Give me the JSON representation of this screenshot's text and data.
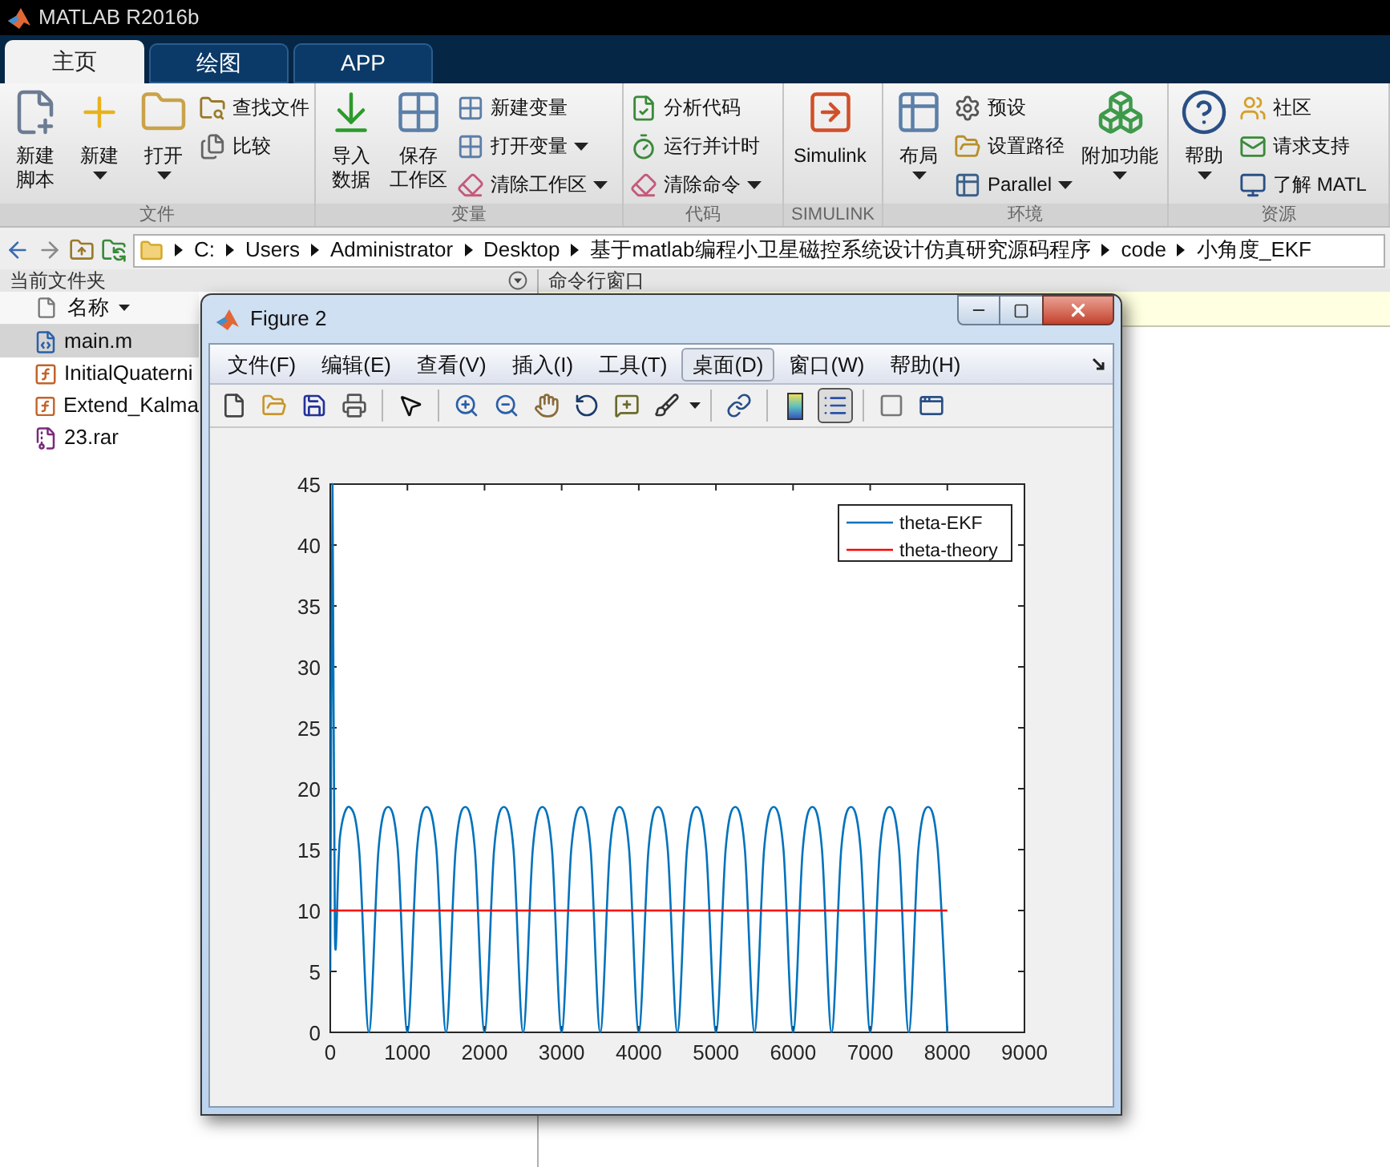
{
  "window": {
    "title": "MATLAB R2016b"
  },
  "tabs": [
    {
      "label": "主页",
      "selected": true
    },
    {
      "label": "绘图",
      "selected": false
    },
    {
      "label": "APP",
      "selected": false
    }
  ],
  "ribbon": {
    "sections": [
      {
        "label": "文件",
        "items": [
          {
            "kind": "large",
            "lines": [
              "新建",
              "脚本"
            ],
            "dropdown": false
          },
          {
            "kind": "large",
            "lines": [
              "新建"
            ],
            "dropdown": true
          },
          {
            "kind": "large",
            "lines": [
              "打开"
            ],
            "dropdown": true
          },
          {
            "kind": "small",
            "items": [
              {
                "label": "查找文件",
                "dropdown": false
              },
              {
                "label": "比较",
                "dropdown": false
              }
            ]
          }
        ]
      },
      {
        "label": "变量",
        "items": [
          {
            "kind": "large",
            "lines": [
              "导入",
              "数据"
            ],
            "dropdown": false
          },
          {
            "kind": "large",
            "lines": [
              "保存",
              "工作区"
            ],
            "dropdown": false
          },
          {
            "kind": "small",
            "items": [
              {
                "label": "新建变量",
                "dropdown": false
              },
              {
                "label": "打开变量",
                "dropdown": true
              },
              {
                "label": "清除工作区",
                "dropdown": true
              }
            ]
          }
        ]
      },
      {
        "label": "代码",
        "items": [
          {
            "kind": "small",
            "items": [
              {
                "label": "分析代码",
                "dropdown": false
              },
              {
                "label": "运行并计时",
                "dropdown": false
              },
              {
                "label": "清除命令",
                "dropdown": true
              }
            ]
          }
        ]
      },
      {
        "label": "SIMULINK",
        "items": [
          {
            "kind": "large",
            "lines": [
              "Simulink"
            ],
            "dropdown": false
          }
        ]
      },
      {
        "label": "环境",
        "items": [
          {
            "kind": "large",
            "lines": [
              "布局"
            ],
            "dropdown": true
          },
          {
            "kind": "small",
            "items": [
              {
                "label": "预设",
                "dropdown": false
              },
              {
                "label": "设置路径",
                "dropdown": false
              },
              {
                "label": "Parallel",
                "dropdown": true
              }
            ]
          },
          {
            "kind": "large",
            "lines": [
              "附加功能"
            ],
            "dropdown": true
          }
        ]
      },
      {
        "label": "资源",
        "items": [
          {
            "kind": "large",
            "lines": [
              "帮助"
            ],
            "dropdown": true
          },
          {
            "kind": "small",
            "items": [
              {
                "label": "社区",
                "dropdown": false
              },
              {
                "label": "请求支持",
                "dropdown": false
              },
              {
                "label": "了解 MATL",
                "dropdown": false
              }
            ]
          }
        ]
      }
    ]
  },
  "address_bar": {
    "segments": [
      "C:",
      "Users",
      "Administrator",
      "Desktop",
      "基于matlab编程小卫星磁控系统设计仿真研究源码程序",
      "code",
      "小角度_EKF"
    ]
  },
  "file_panel": {
    "title": "当前文件夹",
    "column": "名称",
    "files": [
      {
        "name": "main.m",
        "kind": "script",
        "selected": true
      },
      {
        "name": "InitialQuaterni",
        "kind": "function",
        "selected": false
      },
      {
        "name": "Extend_Kalma",
        "kind": "function",
        "selected": false
      },
      {
        "name": "23.rar",
        "kind": "archive",
        "selected": false
      }
    ]
  },
  "command_window": {
    "title": "命令行窗口"
  },
  "figure": {
    "title": "Figure 2",
    "menu": [
      {
        "label": "文件(F)",
        "selected": false
      },
      {
        "label": "编辑(E)",
        "selected": false
      },
      {
        "label": "查看(V)",
        "selected": false
      },
      {
        "label": "插入(I)",
        "selected": false
      },
      {
        "label": "工具(T)",
        "selected": false
      },
      {
        "label": "桌面(D)",
        "selected": true
      },
      {
        "label": "窗口(W)",
        "selected": false
      },
      {
        "label": "帮助(H)",
        "selected": false
      }
    ],
    "toolbar_groups": [
      {
        "tools": [
          {
            "kind": "new",
            "pressed": false,
            "dropdown": false
          },
          {
            "kind": "open",
            "pressed": false,
            "dropdown": false
          },
          {
            "kind": "save",
            "pressed": false,
            "dropdown": false
          },
          {
            "kind": "print",
            "pressed": false,
            "dropdown": false
          }
        ]
      },
      {
        "tools": [
          {
            "kind": "pointer",
            "pressed": false,
            "dropdown": false
          }
        ]
      },
      {
        "tools": [
          {
            "kind": "zoomin",
            "pressed": false,
            "dropdown": false
          },
          {
            "kind": "zoomout",
            "pressed": false,
            "dropdown": false
          },
          {
            "kind": "pan",
            "pressed": false,
            "dropdown": false
          },
          {
            "kind": "rotate",
            "pressed": false,
            "dropdown": false
          },
          {
            "kind": "datatip",
            "pressed": false,
            "dropdown": false
          },
          {
            "kind": "brush",
            "pressed": false,
            "dropdown": true
          }
        ]
      },
      {
        "tools": [
          {
            "kind": "link",
            "pressed": false,
            "dropdown": false
          }
        ]
      },
      {
        "tools": [
          {
            "kind": "colorbar",
            "pressed": false,
            "dropdown": false
          },
          {
            "kind": "legend",
            "pressed": true,
            "dropdown": false
          }
        ]
      },
      {
        "tools": [
          {
            "kind": "hide",
            "pressed": false,
            "dropdown": false
          },
          {
            "kind": "dock",
            "pressed": false,
            "dropdown": false
          }
        ]
      }
    ],
    "chart_data": {
      "type": "line",
      "legend": "top right",
      "xlim": [
        0,
        9000
      ],
      "ylim": [
        0,
        45
      ],
      "xticks": [
        0,
        1000,
        2000,
        3000,
        4000,
        5000,
        6000,
        7000,
        8000,
        9000
      ],
      "yticks": [
        0,
        5,
        10,
        15,
        20,
        25,
        30,
        35,
        40,
        45
      ],
      "x": [
        0,
        30,
        60,
        125,
        250,
        375,
        500,
        625,
        750,
        875,
        1000,
        1125,
        1250,
        1375,
        1500,
        1625,
        1750,
        1875,
        2000,
        2125,
        2250,
        2375,
        2500,
        2625,
        2750,
        2875,
        3000,
        3125,
        3250,
        3375,
        3500,
        3625,
        3750,
        3875,
        4000,
        4125,
        4250,
        4375,
        4500,
        4625,
        4750,
        4875,
        5000,
        5125,
        5250,
        5375,
        5500,
        5625,
        5750,
        5875,
        6000,
        6125,
        6250,
        6375,
        6500,
        6625,
        6750,
        6875,
        7000,
        7125,
        7250,
        7375,
        7500,
        7625,
        7750,
        7875,
        8000
      ],
      "series": [
        {
          "name": "theta-EKF",
          "color": "#0072bd",
          "values": [
            5,
            45,
            8,
            16,
            18.5,
            15,
            0,
            15,
            18.5,
            15,
            0,
            15,
            18.5,
            15,
            0,
            15,
            18.5,
            15,
            0,
            15,
            18.5,
            15,
            0,
            15,
            18.5,
            15,
            0,
            15,
            18.5,
            15,
            0,
            15,
            18.5,
            15,
            0,
            15,
            18.5,
            15,
            0,
            15,
            18.5,
            15,
            0,
            15,
            18.5,
            15,
            0,
            15,
            18.5,
            15,
            0,
            15,
            18.5,
            15,
            0,
            15,
            18.5,
            15,
            0,
            15,
            18.5,
            15,
            0,
            15,
            18.5,
            15,
            0
          ]
        },
        {
          "name": "theta-theory",
          "color": "#ff0000",
          "values": [
            10,
            10,
            10,
            10,
            10,
            10,
            10,
            10,
            10,
            10,
            10,
            10,
            10,
            10,
            10,
            10,
            10,
            10,
            10,
            10,
            10,
            10,
            10,
            10,
            10,
            10,
            10,
            10,
            10,
            10,
            10,
            10,
            10,
            10,
            10,
            10,
            10,
            10,
            10,
            10,
            10,
            10,
            10,
            10,
            10,
            10,
            10,
            10,
            10,
            10,
            10,
            10,
            10,
            10,
            10,
            10,
            10,
            10,
            10,
            10,
            10,
            10,
            10,
            10,
            10,
            10,
            10
          ]
        }
      ]
    }
  }
}
